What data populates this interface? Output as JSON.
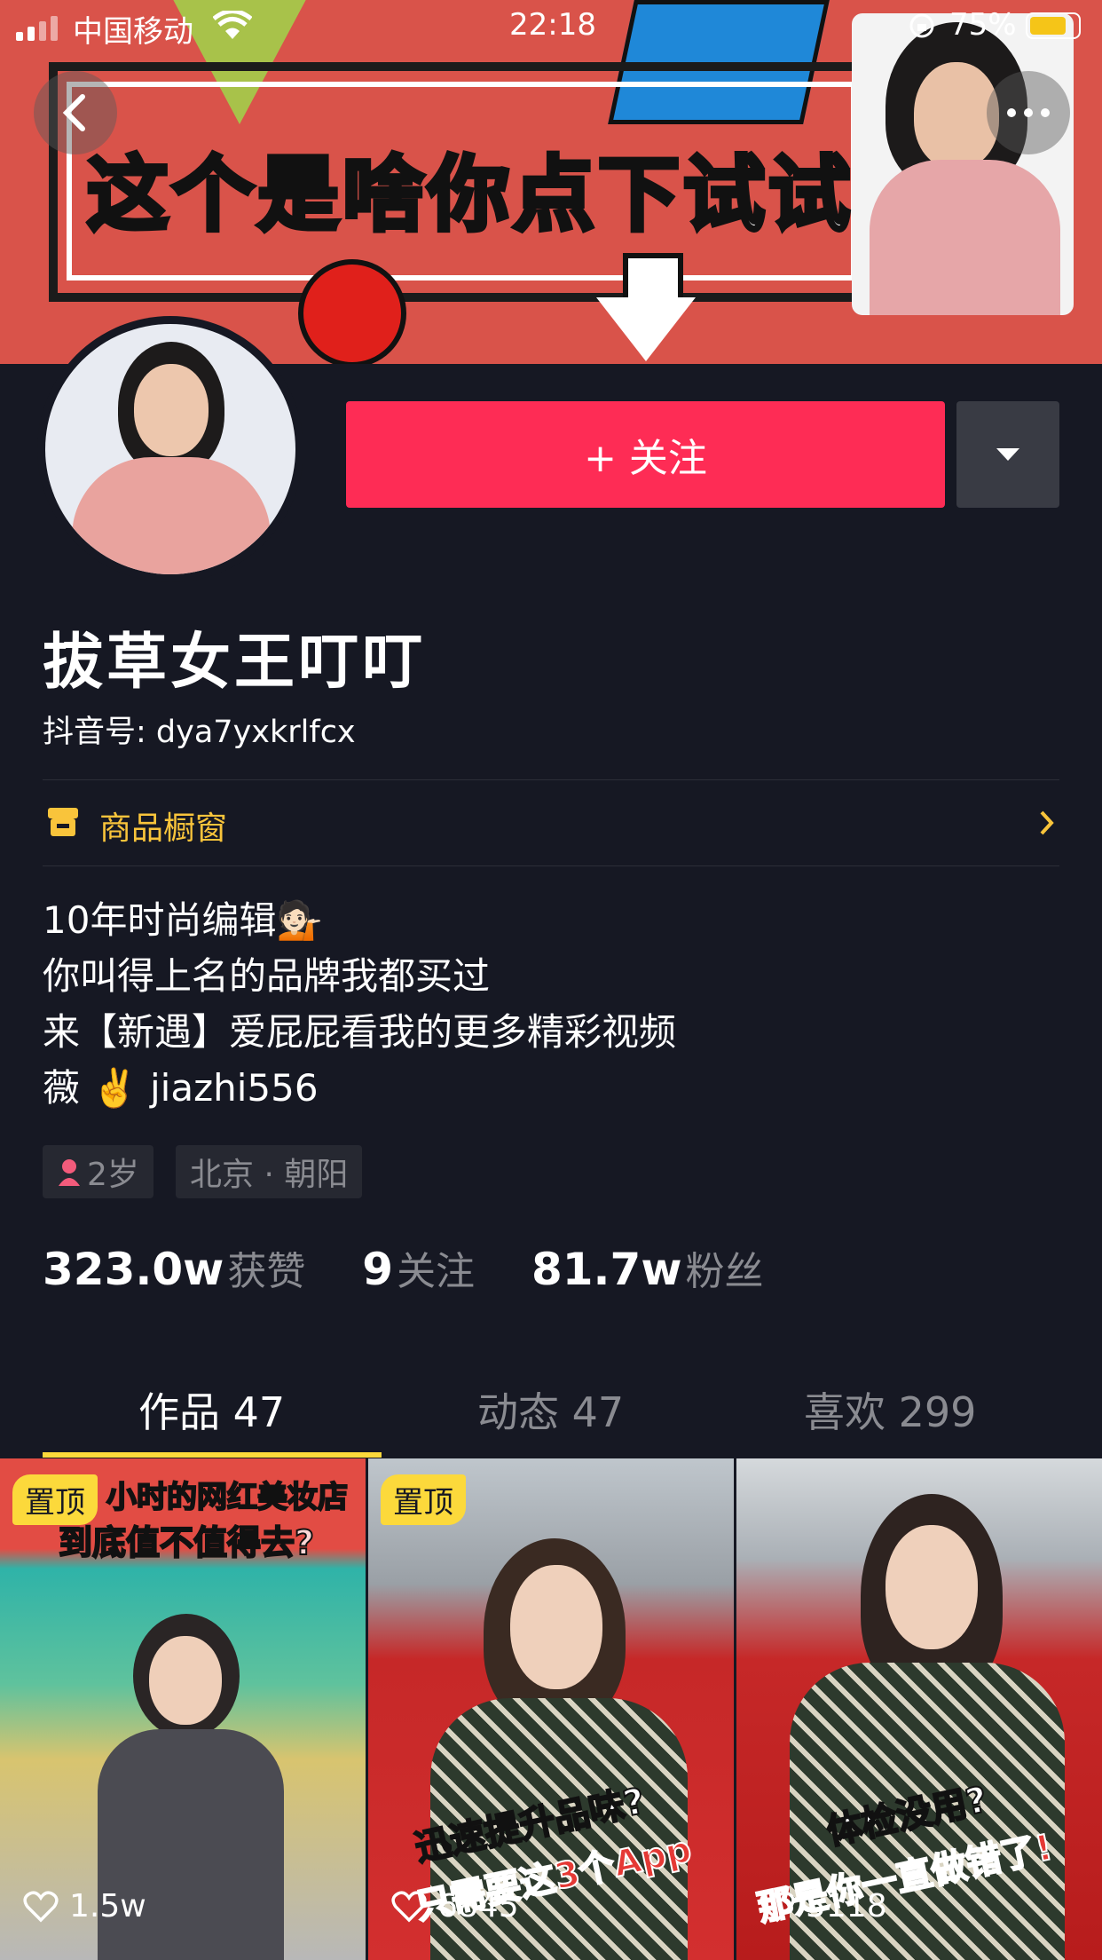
{
  "status_bar": {
    "carrier": "中国移动",
    "time": "22:18",
    "battery": "75%"
  },
  "banner": {
    "text": "这个是啥你点下试试"
  },
  "follow_button": {
    "label": "+ 关注"
  },
  "profile": {
    "name": "拔草女王叮叮",
    "douyin_id": "抖音号: dya7yxkrlfcx",
    "shop_label": "商品橱窗",
    "bio": [
      "10年时尚编辑💁🏻",
      "你叫得上名的品牌我都买过",
      "来【新遇】爱屁屁看我的更多精彩视频",
      "薇 ✌️ jiazhi556"
    ],
    "tags": {
      "age": "2岁",
      "location": "北京 · 朝阳"
    }
  },
  "stats": {
    "likes_num": "323.0w",
    "likes_label": "获赞",
    "following_num": "9",
    "following_label": "关注",
    "fans_num": "81.7w",
    "fans_label": "粉丝"
  },
  "tabs": [
    {
      "label": "作品 47",
      "active": true
    },
    {
      "label": "动态 47",
      "active": false
    },
    {
      "label": "喜欢 299",
      "active": false
    }
  ],
  "videos": [
    {
      "pinned": "置顶",
      "likes": "1.5w",
      "caption_top": "小时的网红美妆店",
      "caption_top2": "到底值不值得去?"
    },
    {
      "pinned": "置顶",
      "likes": "6845",
      "caption_1": "迅速提升品味?",
      "caption_2": "只需要这3个App"
    },
    {
      "likes": "5118",
      "caption_1": "体检没用?",
      "caption_2": "那是你一直做错了!"
    }
  ],
  "colors": {
    "background": "#161823",
    "accent": "#fe2c55",
    "gold": "#f9c43b",
    "tab_indicator": "#fcd93b"
  }
}
